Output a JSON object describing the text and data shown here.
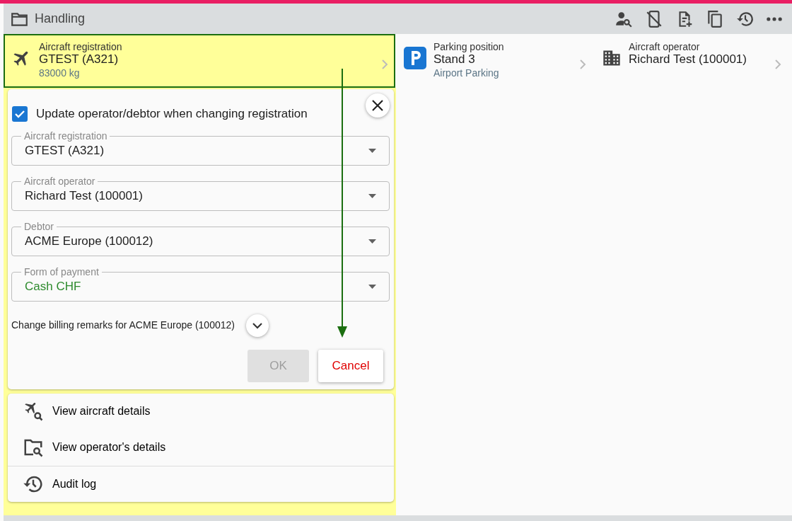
{
  "window": {
    "title": "Handling"
  },
  "tiles": [
    {
      "label": "Aircraft registration",
      "value": "GTEST (A321)",
      "sub": "83000 kg",
      "selected": true
    },
    {
      "label": "Parking position",
      "value": "Stand 3",
      "sub": "Airport Parking",
      "selected": false
    },
    {
      "label": "Aircraft operator",
      "value": "Richard Test (100001)",
      "selected": false
    }
  ],
  "dialog": {
    "checkbox": {
      "label": "Update operator/debtor when changing registration",
      "checked": true
    },
    "fields": [
      {
        "label": "Aircraft registration",
        "value": "GTEST (A321)",
        "color": "#212121"
      },
      {
        "label": "Aircraft operator",
        "value": "Richard Test (100001)",
        "color": "#212121"
      },
      {
        "label": "Debtor",
        "value": "ACME Europe (100012)",
        "color": "#212121"
      },
      {
        "label": "Form of payment",
        "value": "Cash CHF",
        "color": "#2e8b2e"
      }
    ],
    "billing_remarks": {
      "label": "Change billing remarks for ACME Europe (100012)",
      "expanded": false
    },
    "buttons": [
      {
        "label": "OK",
        "kind": "primary",
        "disabled": true
      },
      {
        "label": "Cancel",
        "kind": "cancel",
        "disabled": false
      }
    ]
  },
  "menu": [
    {
      "label": "View aircraft details",
      "divider_before": false
    },
    {
      "label": "View operator's details",
      "divider_before": false
    },
    {
      "label": "Audit log",
      "divider_before": true
    }
  ]
}
